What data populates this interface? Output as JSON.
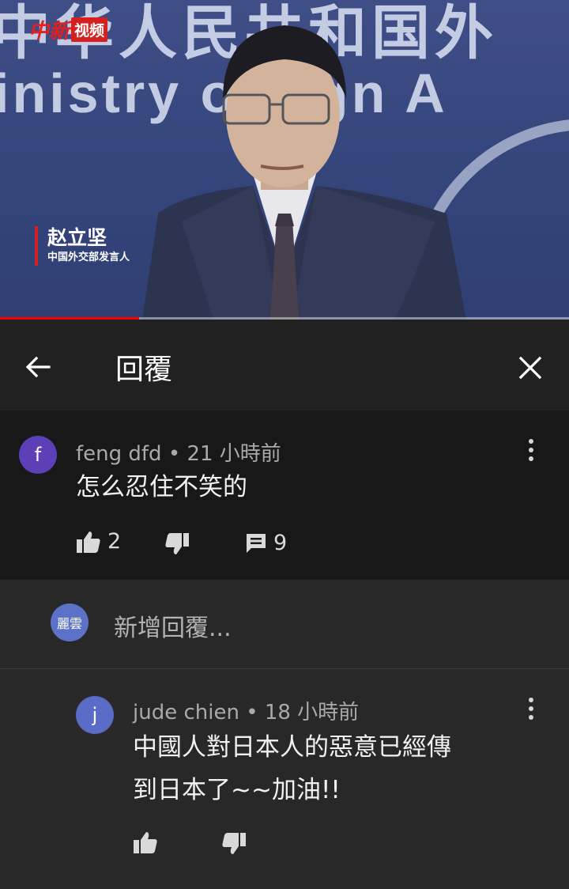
{
  "video": {
    "logo_red": "中新",
    "logo_box": "视频",
    "backdrop_cn": "中华人民共和国外",
    "backdrop_en": "inistry  oreign A",
    "caption_name": "赵立坚",
    "caption_role": "中国外交部发言人",
    "progress_fraction": 0.245
  },
  "header": {
    "title": "回覆",
    "back_icon": "arrow-left-icon",
    "close_icon": "close-icon"
  },
  "comment": {
    "avatar_letter": "f",
    "avatar_color": "#5d3fb8",
    "author": "feng dfd",
    "time": "21 小時前",
    "text": "怎么忍住不笑的",
    "likes": "2",
    "replies": "9"
  },
  "add_reply": {
    "avatar_text": "麗雲",
    "placeholder": "新增回覆..."
  },
  "reply": {
    "avatar_letter": "j",
    "avatar_color": "#5a6bc8",
    "author": "jude chien",
    "time": "18 小時前",
    "text_line1": "中國人對日本人的惡意已經傳",
    "text_line2": "到日本了~~加油!!"
  },
  "colors": {
    "progress": "#ff0000",
    "header_bg": "#212121",
    "comment_bg": "#181818",
    "page_bg": "#282828"
  }
}
